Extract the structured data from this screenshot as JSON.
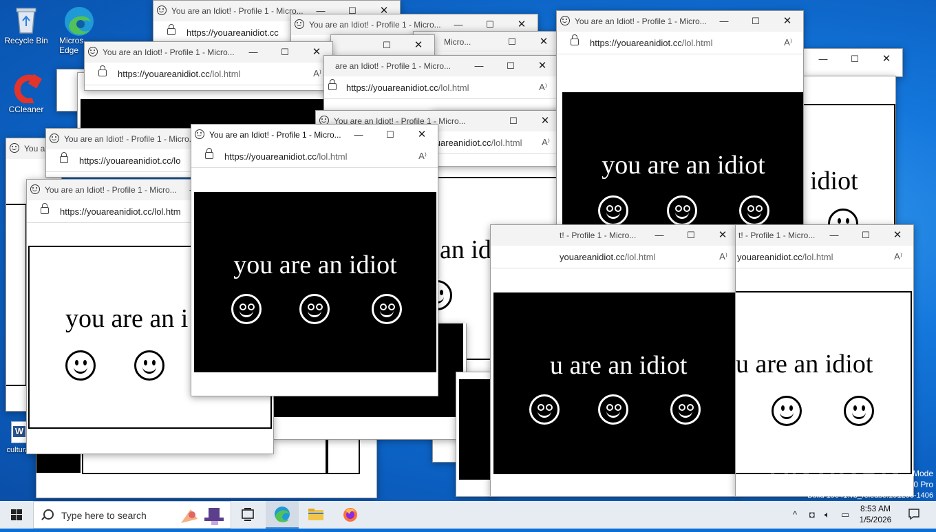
{
  "desktop": {
    "icons": [
      {
        "label": "Recycle Bin",
        "icon": "recycle-bin-icon"
      },
      {
        "label": "Microsoft Edge",
        "visible_label": "Micros Edge",
        "icon": "edge-icon"
      },
      {
        "label": "CCleaner",
        "icon": "ccleaner-icon"
      },
      {
        "label": "culturals",
        "icon": "word-doc-icon"
      }
    ]
  },
  "popup": {
    "title": "You are an Idiot! - Profile 1 - Micro...",
    "title_partial_a": "You are an Idiot! - Profile 1 - Micro...",
    "title_partial_b": "are an Idiot! - Profile 1 - Micro...",
    "title_partial_c": "t! - Profile 1 - Micro...",
    "title_partial_d": "You ar",
    "title_partial_e": "Micro...",
    "url_host": "https://youareanidiot.cc",
    "url_path": "/lol.html",
    "url_partial_a": "youareanidiot.cc",
    "url_partial_b": "https://youareanidiot.cc/lo",
    "url_partial_c": "https://youareanidiot.cc/lol.htm",
    "url_partial_d": "youareanidiot.cc/lol.html",
    "message": "you are an idiot",
    "message_partial_a": "you are an i",
    "message_partial_b": "an idiot",
    "message_partial_c": "u are an idiot",
    "message_partial_d": "idiot",
    "min_glyph": "—",
    "max_glyph": "☐",
    "close_glyph": "✕",
    "read_aloud_glyph": "A⁾"
  },
  "watermark": {
    "brand": "ANY.RUN",
    "line1": "Mode",
    "line2": "10 Pro",
    "line3": "Build 19041.vb_release.191206-1406"
  },
  "taskbar": {
    "search_placeholder": "Type here to search",
    "pinned": [
      "task-view-icon",
      "edge-icon",
      "file-explorer-icon",
      "firefox-icon"
    ],
    "time": "8:53 AM",
    "date": "1/5/2026"
  },
  "colors": {
    "desktop_blue": "#1477dc",
    "taskbar": "#e7ecf3",
    "popup_dark": "#000000",
    "popup_light": "#ffffff"
  }
}
